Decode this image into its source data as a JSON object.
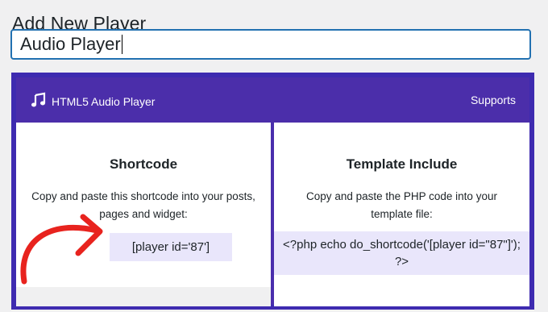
{
  "page": {
    "title": "Add New Player"
  },
  "title_input": {
    "value": "Audio Player"
  },
  "plugin": {
    "brand_icon": "music-note-icon",
    "brand_name": "HTML5 Audio Player",
    "supports_link": "Supports",
    "accent_color": "#4b2eaa",
    "code_bg_color": "#e9e6fb"
  },
  "shortcode_card": {
    "title": "Shortcode",
    "description": "Copy and paste this shortcode into your posts, pages and widget:",
    "code": "[player id='87']"
  },
  "template_card": {
    "title": "Template Include",
    "description": "Copy and paste the PHP code into your template file:",
    "code": "<?php echo do_shortcode('[player id=\"87\"]'); ?>"
  },
  "annotation": {
    "icon": "red-curved-arrow-icon",
    "color": "#e8231e"
  }
}
